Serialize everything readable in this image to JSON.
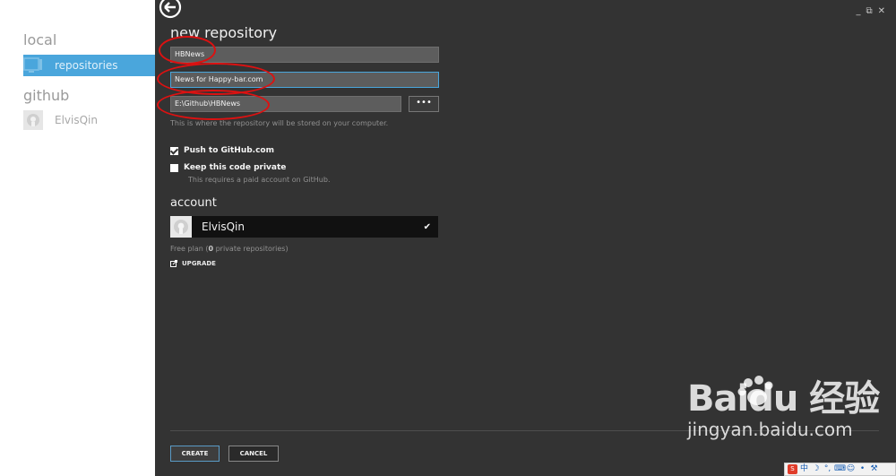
{
  "sidebar": {
    "sections": [
      {
        "heading": "local",
        "items": [
          {
            "label": "repositories"
          }
        ]
      },
      {
        "heading": "github",
        "items": [
          {
            "label": "ElvisQin"
          }
        ]
      }
    ]
  },
  "main": {
    "title": "new repository",
    "name_value": "HBNews",
    "description_value": "News for Happy-bar.com",
    "path_value": "E:\\Github\\HBNews",
    "browse_label": "•••",
    "path_hint": "This is where the repository will be stored on your computer.",
    "push_label": "Push to GitHub.com",
    "private_label": "Keep this code private",
    "private_hint": "This requires a paid account on GitHub.",
    "account_title": "account",
    "account_name": "ElvisQin",
    "plan_prefix": "Free plan (",
    "plan_count": "0",
    "plan_suffix": " private repositories)",
    "upgrade_label": "UPGRADE",
    "create_label": "CREATE",
    "cancel_label": "CANCEL"
  },
  "window_controls": [
    "_",
    "⧉",
    "✕"
  ],
  "watermark": {
    "brand": "Baidu 经验",
    "url": "jingyan.baidu.com"
  },
  "tray": [
    "S",
    "中",
    "☽",
    "°,",
    "⌨",
    "☺",
    "•",
    "⚒"
  ],
  "colors": {
    "accent": "#4aa6dc",
    "panel": "#333333",
    "annotation": "#dd1111"
  }
}
